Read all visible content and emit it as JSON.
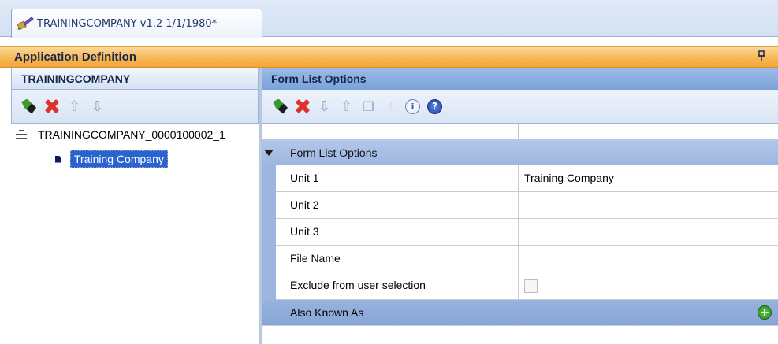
{
  "tab": {
    "title": "TRAININGCOMPANY v1.2 1/1/1980*"
  },
  "app_header": {
    "title": "Application Definition",
    "pin": "ᵖ"
  },
  "left": {
    "title": "TRAININGCOMPANY",
    "tree": {
      "root": "TRAININGCOMPANY_0000100002_1",
      "child": "Training Company"
    }
  },
  "right": {
    "title": "Form List Options",
    "grid": {
      "category": "Form List Options",
      "rows": [
        {
          "name": "Unit 1",
          "value": "Training Company"
        },
        {
          "name": "Unit 2",
          "value": ""
        },
        {
          "name": "Unit 3",
          "value": ""
        },
        {
          "name": "File Name",
          "value": ""
        },
        {
          "name": "Exclude from user selection",
          "value": ""
        }
      ],
      "also_known_as": "Also Known As"
    }
  },
  "icons": {
    "info": "i",
    "help": "?",
    "add_plus": "+"
  }
}
